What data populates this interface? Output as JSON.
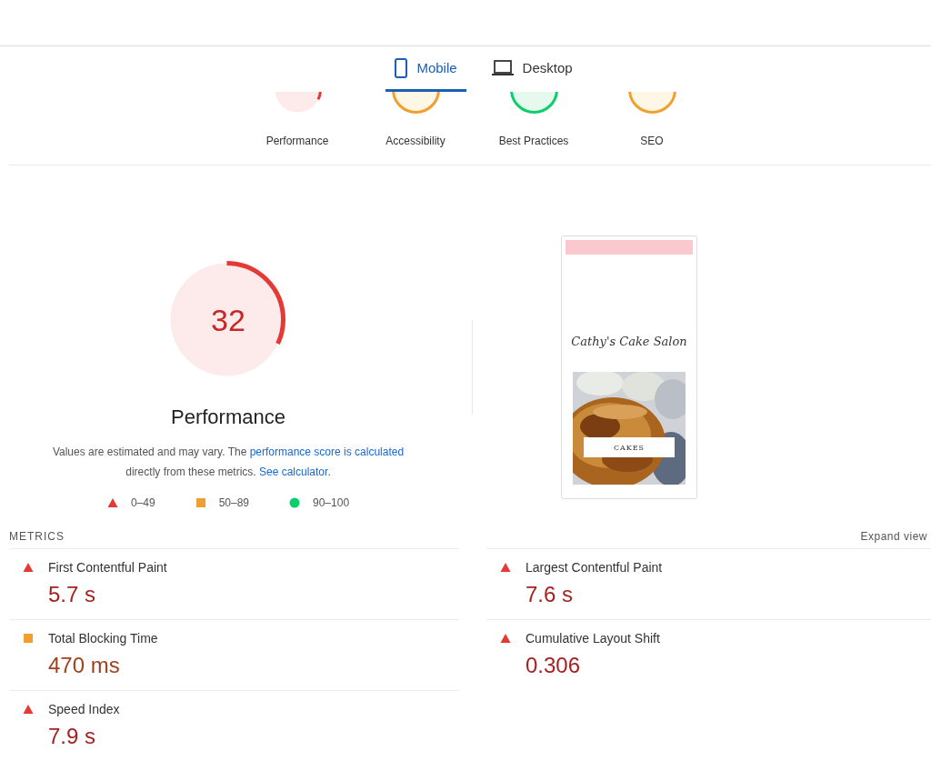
{
  "tabs": [
    {
      "label": "Mobile",
      "selected": true
    },
    {
      "label": "Desktop",
      "selected": false
    }
  ],
  "categories": [
    {
      "label": "Performance",
      "kind": "fail"
    },
    {
      "label": "Accessibility",
      "kind": "average"
    },
    {
      "label": "Best Practices",
      "kind": "pass"
    },
    {
      "label": "SEO",
      "kind": "average"
    }
  ],
  "performance": {
    "score": "32",
    "kind": "fail",
    "level": 0.32,
    "title": "Performance",
    "note_parts": [
      {
        "kind": "text",
        "text": "Values are estimated and may vary. The "
      },
      {
        "kind": "link",
        "text": "performance score is calculated"
      },
      {
        "kind": "text",
        "text": " directly from these metrics. "
      },
      {
        "kind": "link",
        "text": "See calculator"
      },
      {
        "kind": "text",
        "text": "."
      }
    ]
  },
  "legend": [
    {
      "kind": "fail",
      "label": "0–49"
    },
    {
      "kind": "average",
      "label": "50–89"
    },
    {
      "kind": "pass",
      "label": "90–100"
    }
  ],
  "preview": {
    "site_title": "Cathy's Cake Salon",
    "button": "CAKES"
  },
  "metrics": {
    "heading": "METRICS",
    "expand": "Expand view",
    "items": [
      {
        "label": "First Contentful Paint",
        "value": "5.7 s",
        "kind": "fail"
      },
      {
        "label": "Largest Contentful Paint",
        "value": "7.6 s",
        "kind": "fail"
      },
      {
        "label": "Total Blocking Time",
        "value": "470 ms",
        "kind": "average"
      },
      {
        "label": "Cumulative Layout Shift",
        "value": "0.306",
        "kind": "fail"
      },
      {
        "label": "Speed Index",
        "value": "7.9 s",
        "kind": "fail"
      }
    ]
  }
}
